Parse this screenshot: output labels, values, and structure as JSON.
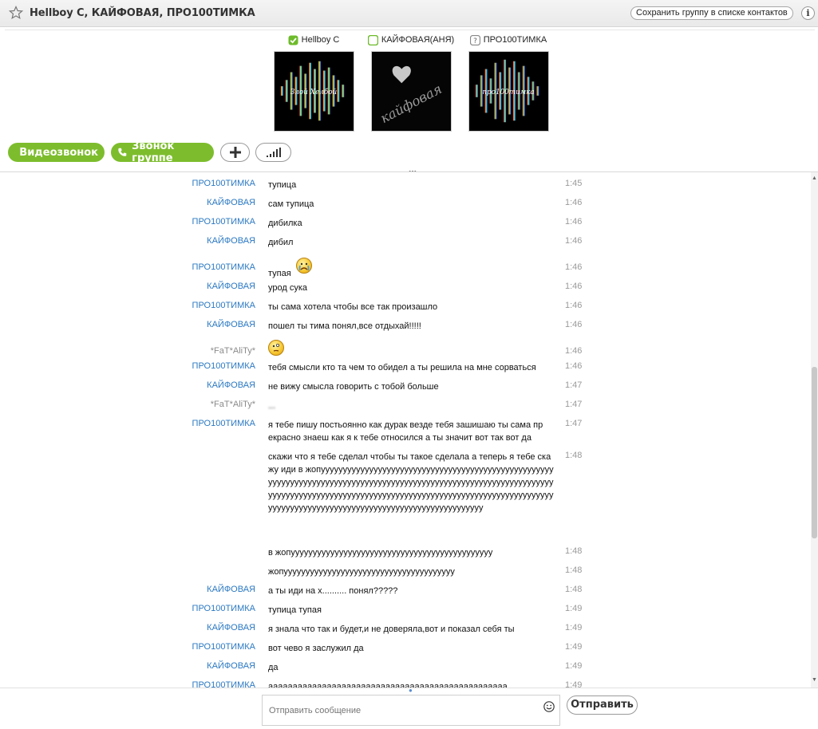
{
  "header": {
    "title": "Hellboy C, КАЙФОВАЯ, ПРО100ТИМКА",
    "save_group_label": "Сохранить группу в списке контактов",
    "info_label": "i"
  },
  "participants": [
    {
      "name": "Hellboy C",
      "status": "online",
      "avatar_text": "Злой Хелбой"
    },
    {
      "name": "КАЙФОВАЯ(АНЯ)",
      "status": "online",
      "avatar_text": "кайфовая"
    },
    {
      "name": "ПРО100ТИМКА",
      "status": "unknown",
      "avatar_text": "про100тимка"
    }
  ],
  "call_buttons": {
    "video_label": "Видеозвонок",
    "group_call_label": "Звонок группе"
  },
  "dots": "...",
  "messages": [
    {
      "sender": "ПРО100ТИМКА",
      "text": "тупица",
      "time": "1:45"
    },
    {
      "sender": "КАЙФОВАЯ",
      "text": "сам тупица",
      "time": "1:46"
    },
    {
      "sender": "ПРО100ТИМКА",
      "text": "дибилка",
      "time": "1:46"
    },
    {
      "sender": "КАЙФОВАЯ",
      "text": "дибил",
      "time": "1:46"
    },
    {
      "sender": "ПРО100ТИМКА",
      "text": "тупая",
      "time": "1:46",
      "emoji": "crying-face"
    },
    {
      "sender": "КАЙФОВАЯ",
      "text": "урод сука",
      "time": "1:46"
    },
    {
      "sender": "ПРО100ТИМКА",
      "text": "ты сама хотела чтобы все так произашло",
      "time": "1:46"
    },
    {
      "sender": "КАЙФОВАЯ",
      "text": "пошел ты тима понял,все отдыхай!!!!!",
      "time": "1:46"
    },
    {
      "sender": "*FaT*AliTy*",
      "text": "",
      "time": "1:46",
      "emoji": "thinking-face"
    },
    {
      "sender": "ПРО100ТИМКА",
      "text": "тебя смысли кто та чем то обидел а ты решила на мне сорваться",
      "time": "1:46"
    },
    {
      "sender": "КАЙФОВАЯ",
      "text": "не вижу смысла говорить с тобой больше",
      "time": "1:47"
    },
    {
      "sender": "*FaT*AliTy*",
      "text": "...",
      "time": "1:47"
    },
    {
      "sender": "ПРО100ТИМКА",
      "text": "я тебе пишу постьоянно как дурак везде тебя зашишаю ты сама прекрасно знаеш как я к тебе относился а ты значит вот так вот да",
      "time": "1:47"
    },
    {
      "sender": "",
      "text": "скажи что я тебе сделал чтобы ты такое сделала а теперь я тебе скажу иди в жопуууууууууууууууууууууууууууууууууууууууууууууууууууууууууууууууууууууууууууууууууууууууууууууууууууууууууууууууууууууууууууууууууууууууууууууууууууууууууууууууууууууууууууууууууууууууууууууууууууууууууууууууууууууууууууууууууууууууу",
      "time": "1:48"
    },
    {
      "sender": "",
      "text": "в жопуууууууууууууууууууууууууууууууууууууууууууууу",
      "time": "1:48"
    },
    {
      "sender": "",
      "text": "жопууууууууууууууууууууууууууууууууууууууу",
      "time": "1:48"
    },
    {
      "sender": "КАЙФОВАЯ",
      "text": "а ты иди на х.......... понял?????",
      "time": "1:48"
    },
    {
      "sender": "ПРО100ТИМКА",
      "text": "тупица тупая",
      "time": "1:49"
    },
    {
      "sender": "КАЙФОВАЯ",
      "text": "я знала что так и будет,и не доверяла,вот и показал себя ты",
      "time": "1:49"
    },
    {
      "sender": "ПРО100ТИМКА",
      "text": "вот чево я заслужил да",
      "time": "1:49"
    },
    {
      "sender": "КАЙФОВАЯ",
      "text": "да",
      "time": "1:49"
    },
    {
      "sender": "ПРО100ТИМКА",
      "text": "ааааааааааааааааааааааааааааааааааааааааааааааааа",
      "time": "1:49"
    }
  ],
  "composer": {
    "placeholder": "Отправить сообщение",
    "send_label": "Отправить"
  },
  "colors": {
    "accent_green": "#7dbd2d",
    "sender_blue": "#2b79c2",
    "time_gray": "#9a9a9a"
  }
}
